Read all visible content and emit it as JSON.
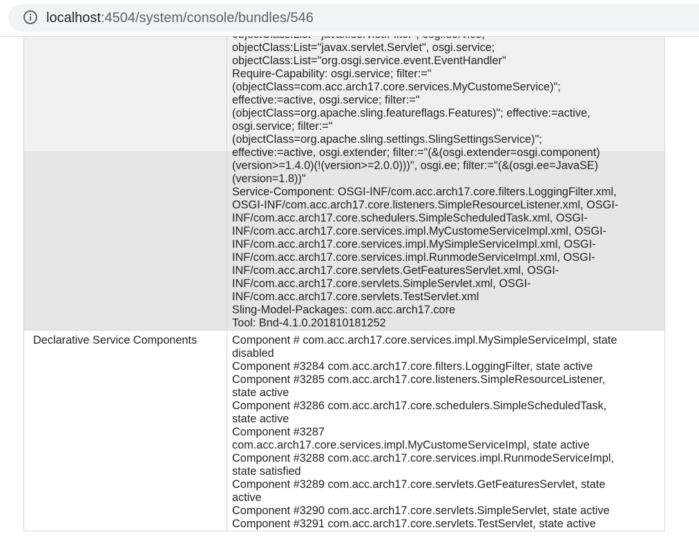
{
  "browser": {
    "url_host": "localhost",
    "url_rest": ":4504/system/console/bundles/546",
    "info_icon": "info-icon"
  },
  "manifest": {
    "lines": [
      "objectClass:List=\"javax.servlet.Filter\", osgi.service;",
      "objectClass:List=\"javax.servlet.Servlet\", osgi.service;",
      "objectClass:List=\"org.osgi.service.event.EventHandler\"",
      "Require-Capability: osgi.service; filter:=\"",
      "(objectClass=com.acc.arch17.core.services.MyCustomeService)\";",
      "effective:=active, osgi.service; filter:=\"",
      "(objectClass=org.apache.sling.featureflags.Features)\"; effective:=active,",
      "osgi.service; filter:=\"",
      "(objectClass=org.apache.sling.settings.SlingSettingsService)\";",
      "effective:=active, osgi.extender; filter:=\"(&(osgi.extender=osgi.component)",
      "(version>=1.4.0)(!(version>=2.0.0)))\", osgi.ee; filter:=\"(&(osgi.ee=JavaSE)",
      "(version=1.8))\"",
      "Service-Component: OSGI-INF/com.acc.arch17.core.filters.LoggingFilter.xml,",
      "OSGI-INF/com.acc.arch17.core.listeners.SimpleResourceListener.xml, OSGI-",
      "INF/com.acc.arch17.core.schedulers.SimpleScheduledTask.xml, OSGI-",
      "INF/com.acc.arch17.core.services.impl.MyCustomeServiceImpl.xml, OSGI-",
      "INF/com.acc.arch17.core.services.impl.MySimpleServiceImpl.xml, OSGI-",
      "INF/com.acc.arch17.core.services.impl.RunmodeServiceImpl.xml, OSGI-",
      "INF/com.acc.arch17.core.servlets.GetFeaturesServlet.xml, OSGI-",
      "INF/com.acc.arch17.core.servlets.SimpleServlet.xml, OSGI-",
      "INF/com.acc.arch17.core.servlets.TestServlet.xml",
      "Sling-Model-Packages: com.acc.arch17.core",
      "Tool: Bnd-4.1.0.201810181252"
    ]
  },
  "ds_components": {
    "label": "Declarative Service Components",
    "lines": [
      "Component # com.acc.arch17.core.services.impl.MySimpleServiceImpl, state",
      "disabled",
      "Component #3284 com.acc.arch17.core.filters.LoggingFilter, state active",
      "Component #3285 com.acc.arch17.core.listeners.SimpleResourceListener,",
      "state active",
      "Component #3286 com.acc.arch17.core.schedulers.SimpleScheduledTask,",
      "state active",
      "Component #3287",
      "com.acc.arch17.core.services.impl.MyCustomeServiceImpl, state active",
      "Component #3288 com.acc.arch17.core.services.impl.RunmodeServiceImpl,",
      "state satisfied",
      "Component #3289 com.acc.arch17.core.servlets.GetFeaturesServlet, state",
      "active",
      "Component #3290 com.acc.arch17.core.servlets.SimpleServlet, state active",
      "Component #3291 com.acc.arch17.core.servlets.TestServlet, state active"
    ]
  }
}
